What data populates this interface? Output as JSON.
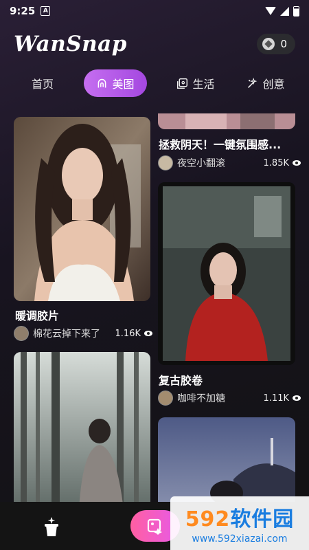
{
  "status": {
    "time": "9:25",
    "app_indicator": "A"
  },
  "header": {
    "logo": "WanSnap",
    "coins": "0"
  },
  "tabs": [
    {
      "label": "首页",
      "icon": "none",
      "active": false
    },
    {
      "label": "美图",
      "icon": "face-outline-icon",
      "active": true
    },
    {
      "label": "生活",
      "icon": "album-icon",
      "active": false
    },
    {
      "label": "创意",
      "icon": "magic-wand-icon",
      "active": false
    }
  ],
  "feed": {
    "left": [
      {
        "title": "暖调胶片",
        "author": "棉花云掉下来了",
        "views": "1.16K"
      },
      {
        "title": "",
        "author": "",
        "views": ""
      }
    ],
    "right": [
      {
        "title": "拯救阴天！一键氛围感...",
        "author": "夜空小翻滚",
        "views": "1.85K"
      },
      {
        "title": "复古胶卷",
        "author": "咖啡不加糖",
        "views": "1.11K"
      },
      {
        "title": "",
        "author": "",
        "views": ""
      }
    ]
  },
  "watermark": {
    "brand_digits": "592",
    "brand_text": "软件园",
    "url": "www.592xiazai.com"
  },
  "colors": {
    "accent": "#b35be6",
    "create": "#ff5fa2",
    "background": "#121212"
  }
}
